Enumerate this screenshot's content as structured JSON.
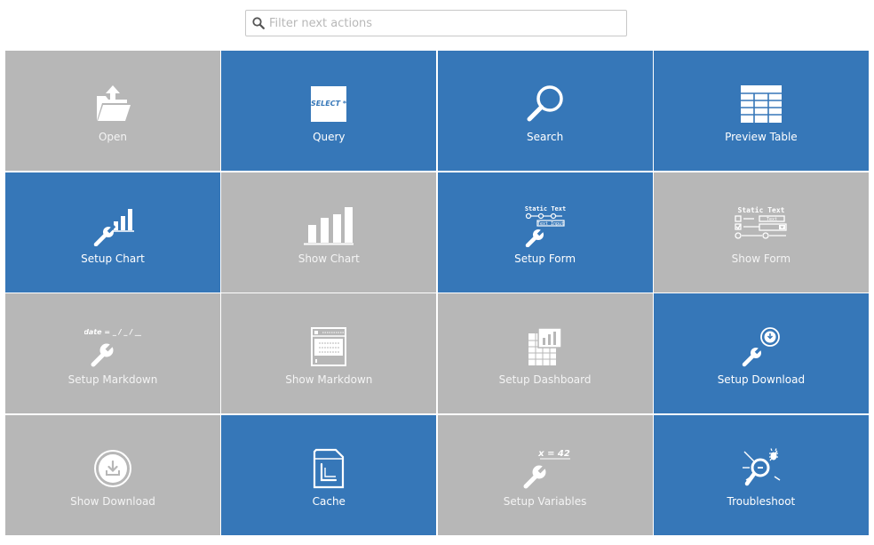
{
  "search": {
    "placeholder": "Filter next actions",
    "value": ""
  },
  "colors": {
    "blue": "#3677b8",
    "gray": "#b7b7b7"
  },
  "tiles": [
    {
      "label": "Open",
      "icon": "folder-open-icon",
      "color": "gray"
    },
    {
      "label": "Query",
      "icon": "select-query-icon",
      "color": "blue",
      "icon_text": "SELECT *"
    },
    {
      "label": "Search",
      "icon": "search-icon",
      "color": "blue"
    },
    {
      "label": "Preview Table",
      "icon": "table-icon",
      "color": "blue"
    },
    {
      "label": "Setup Chart",
      "icon": "wrench-chart-icon",
      "color": "blue"
    },
    {
      "label": "Show Chart",
      "icon": "bar-chart-icon",
      "color": "gray"
    },
    {
      "label": "Setup Form",
      "icon": "wrench-form-icon",
      "color": "blue",
      "icon_text": "Static Text",
      "icon_text2": "Text Input"
    },
    {
      "label": "Show Form",
      "icon": "form-icon",
      "color": "gray",
      "icon_text": "Static Text",
      "icon_text2": "Text"
    },
    {
      "label": "Setup Markdown",
      "icon": "wrench-markdown-icon",
      "color": "gray",
      "icon_text": "date = _ / _ / __"
    },
    {
      "label": "Show Markdown",
      "icon": "markdown-document-icon",
      "color": "gray"
    },
    {
      "label": "Setup Dashboard",
      "icon": "dashboard-icon",
      "color": "gray"
    },
    {
      "label": "Setup Download",
      "icon": "wrench-download-icon",
      "color": "blue"
    },
    {
      "label": "Show Download",
      "icon": "download-icon",
      "color": "gray"
    },
    {
      "label": "Cache",
      "icon": "cache-icon",
      "color": "blue"
    },
    {
      "label": "Setup Variables",
      "icon": "wrench-variables-icon",
      "color": "gray",
      "icon_text": "x = 42"
    },
    {
      "label": "Troubleshoot",
      "icon": "troubleshoot-bug-icon",
      "color": "blue"
    }
  ]
}
